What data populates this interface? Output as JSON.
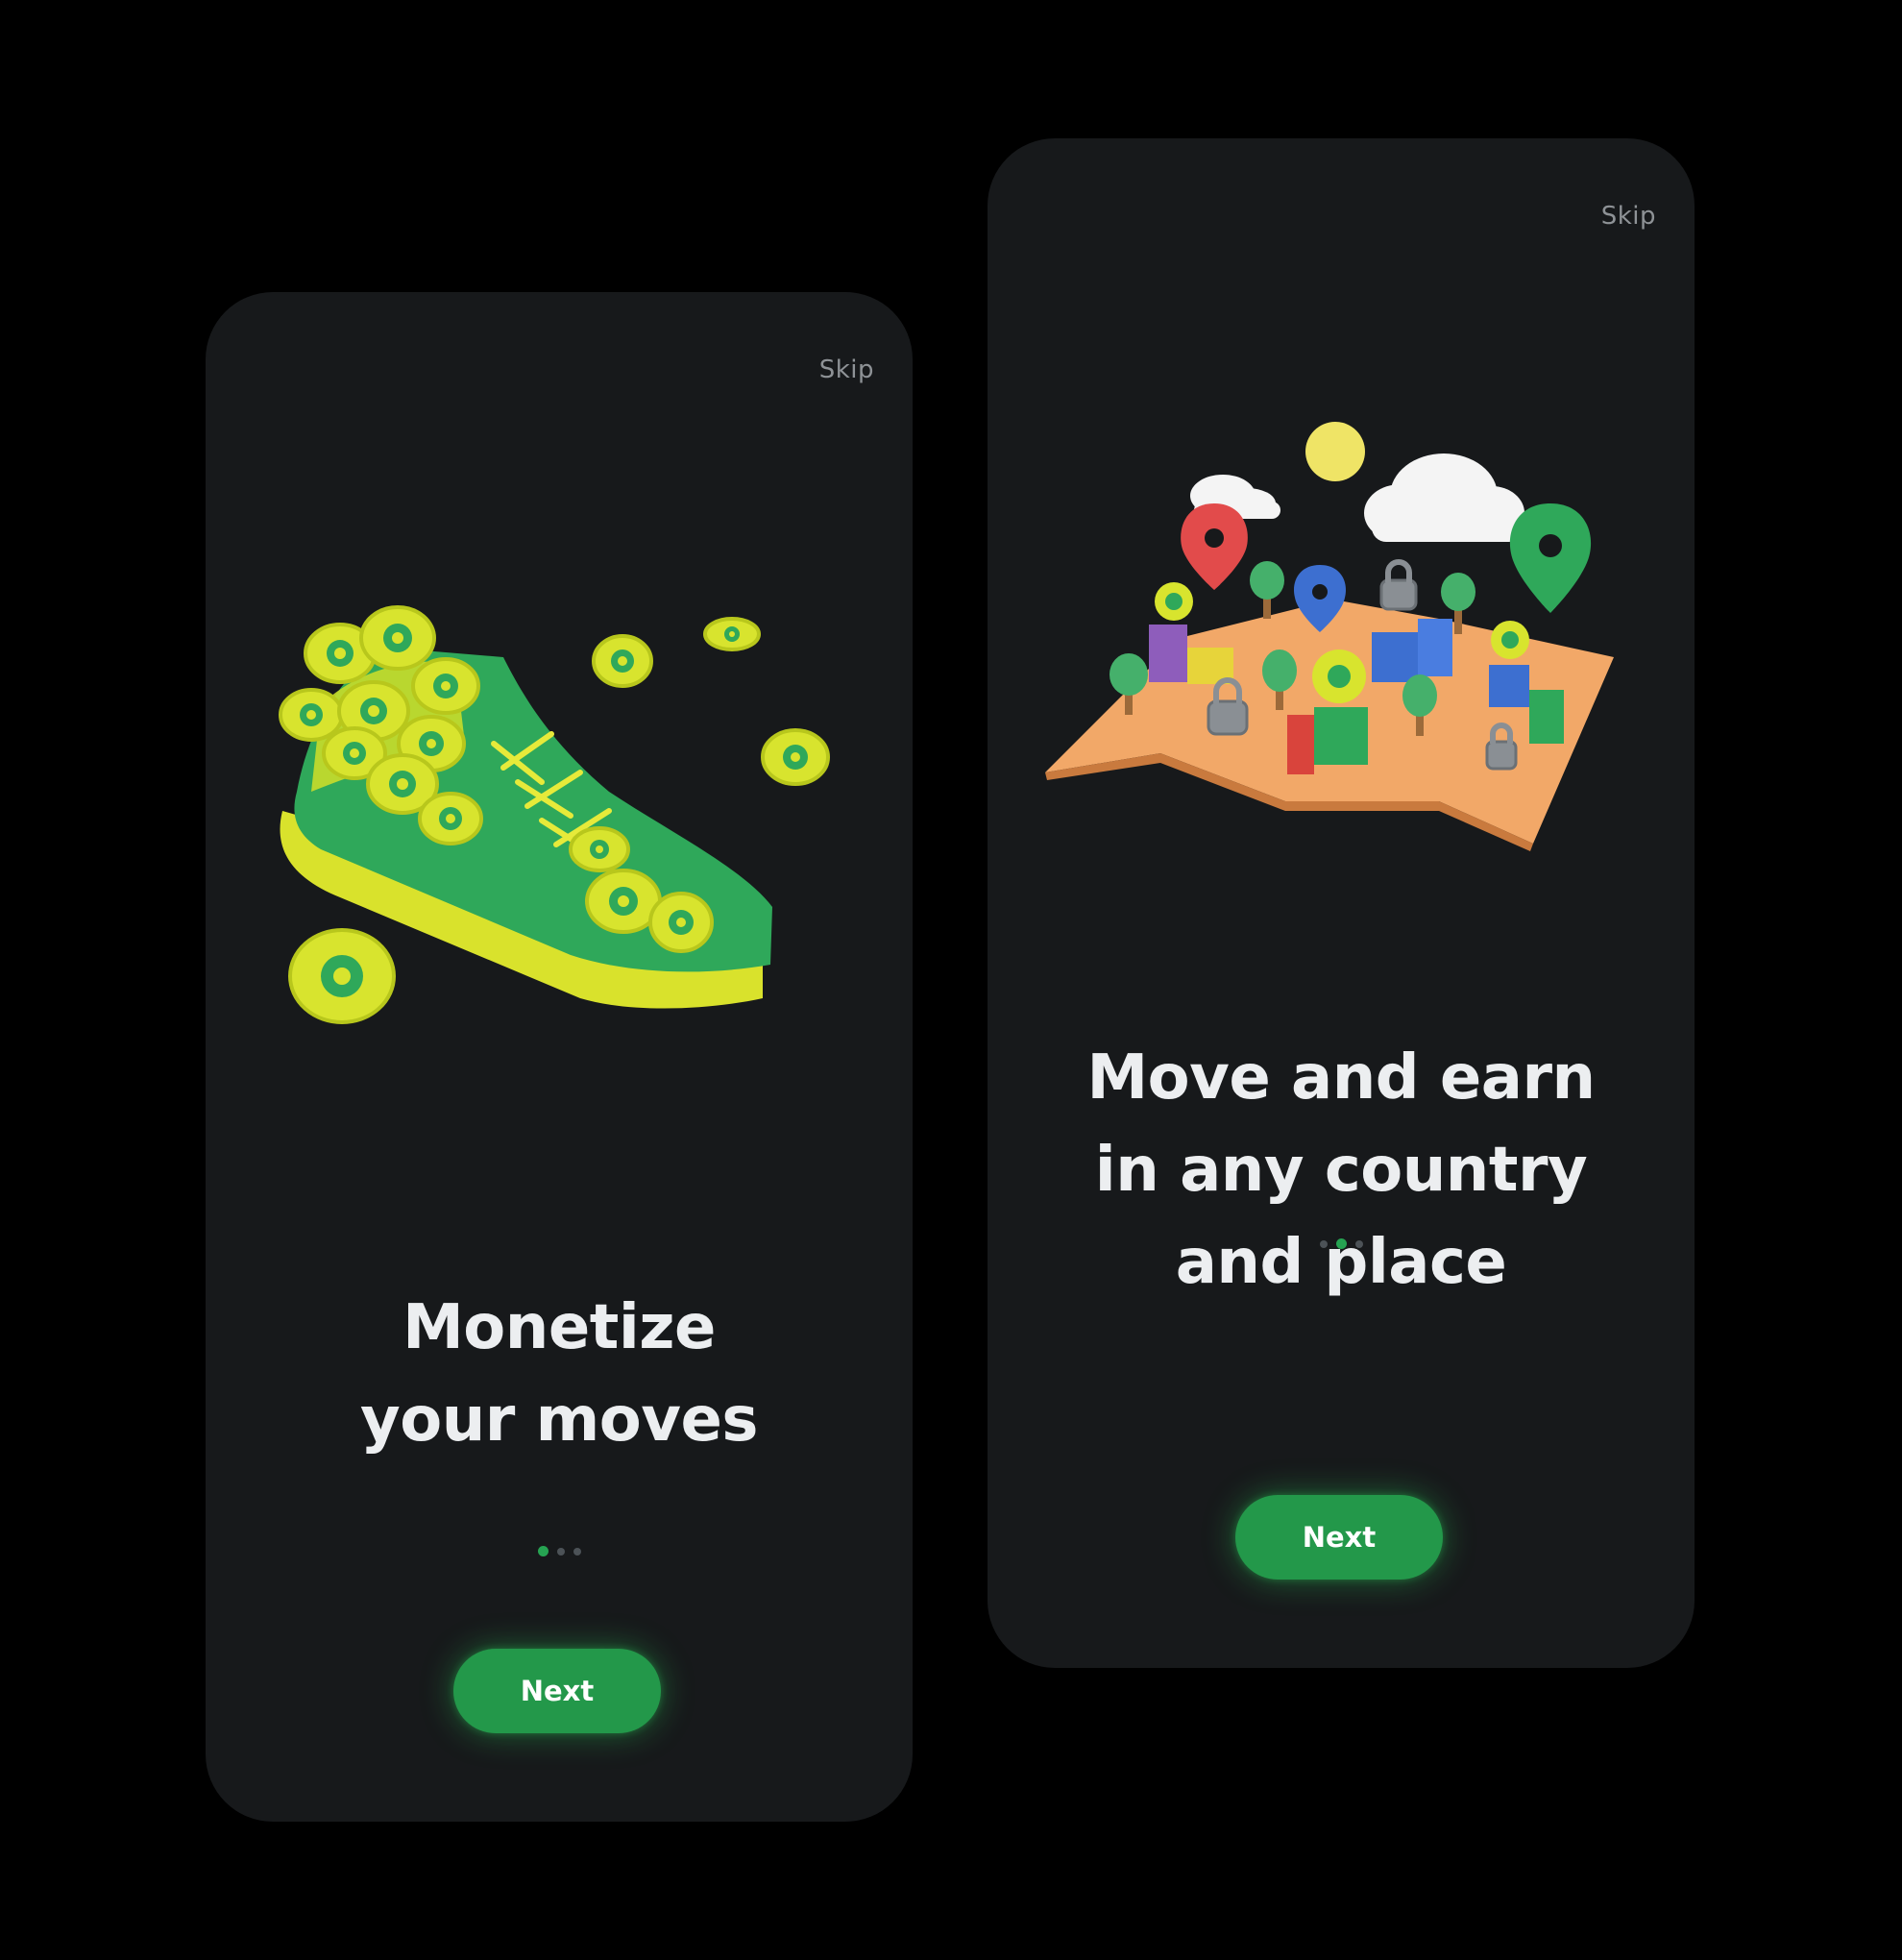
{
  "colors": {
    "page_background": "#000000",
    "card_background": "#17191b",
    "accent_green": "#23984a",
    "headline_text": "#eceef0",
    "skip_text": "#8e9296",
    "dot_inactive": "#4c5257",
    "dot_active": "#26a352"
  },
  "screens": [
    {
      "skip_label": "Skip",
      "illustration": "sneaker-with-coins",
      "headline_lines": [
        "Monetize",
        "your moves"
      ],
      "pagination": {
        "total": 3,
        "active_index": 0
      },
      "next_label": "Next"
    },
    {
      "skip_label": "Skip",
      "illustration": "map-with-location-pins",
      "headline_lines": [
        "Move and earn",
        "in any country",
        "and place"
      ],
      "pagination": {
        "total": 3,
        "active_index": 1
      },
      "next_label": "Next"
    }
  ]
}
